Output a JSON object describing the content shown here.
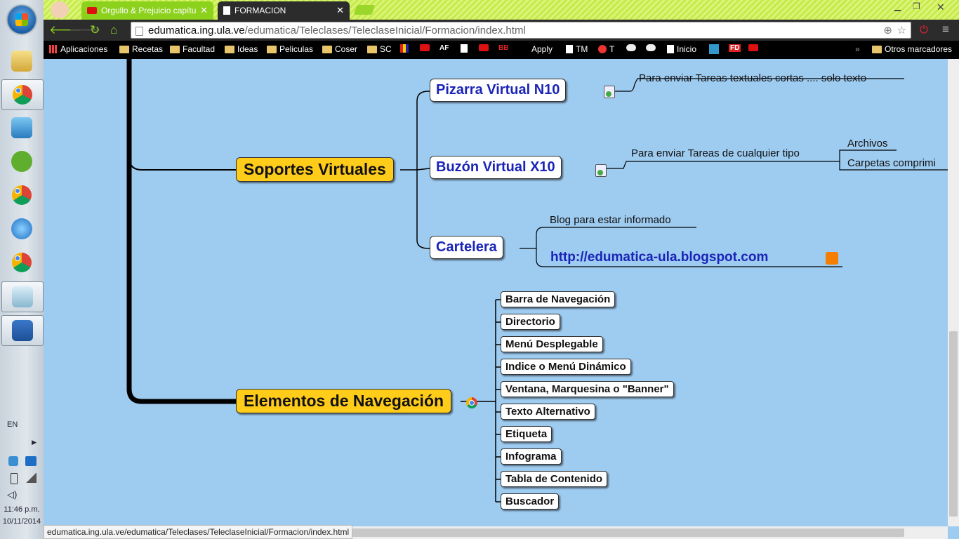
{
  "browser": {
    "tabs": [
      {
        "title": "Orgullo & Prejuicio capítu",
        "active": false,
        "icon": "youtube-icon"
      },
      {
        "title": "FORMACION",
        "active": true,
        "icon": "page-icon"
      }
    ],
    "url_host": "edumatica.ing.ula.ve",
    "url_path": "/edumatica/Teleclases/TeleclaseInicial/Formacion/index.html",
    "status_url": "edumatica.ing.ula.ve/edumatica/Teleclases/TeleclaseInicial/Formacion/index.html",
    "bookmarks": [
      {
        "label": "Aplicaciones",
        "icon": "apps-grid-icon"
      },
      {
        "label": "Recetas",
        "icon": "folder-icon"
      },
      {
        "label": "Facultad",
        "icon": "folder-icon"
      },
      {
        "label": "Ideas",
        "icon": "folder-icon"
      },
      {
        "label": "Peliculas",
        "icon": "folder-icon"
      },
      {
        "label": "Coser",
        "icon": "folder-icon"
      },
      {
        "label": "SC",
        "icon": "folder-icon"
      },
      {
        "label": "Apply",
        "icon": "none"
      },
      {
        "label": "TM",
        "icon": "page-icon"
      },
      {
        "label": "T",
        "icon": "tomato-icon"
      },
      {
        "label": "Inicio",
        "icon": "page-icon"
      }
    ],
    "other_bookmarks": "Otros marcadores"
  },
  "taskbar": {
    "language": "EN",
    "time": "11:46 p.m.",
    "date": "10/11/2014"
  },
  "mindmap": {
    "soportes": {
      "title": "Soportes Virtuales",
      "children": {
        "pizarra": {
          "title": "Pizarra Virtual N10",
          "note": "Para enviar Tareas textuales cortas .... solo texto"
        },
        "buzon": {
          "title": "Buzón Virtual X10",
          "note": "Para enviar Tareas de cualquier tipo",
          "sub1": "Archivos",
          "sub2": "Carpetas comprimi"
        },
        "cartelera": {
          "title": "Cartelera",
          "note": "Blog para estar informado",
          "link": "http://edumatica-ula.blogspot.com"
        }
      }
    },
    "elementos": {
      "title": "Elementos de Navegación",
      "items": [
        "Barra de Navegación",
        "Directorio",
        "Menú Desplegable",
        "Indice o Menú Dinámico",
        "Ventana, Marquesina o \"Banner\"",
        "Texto Alternativo",
        "Etiqueta",
        "Infograma",
        "Tabla de Contenido",
        "Buscador"
      ]
    }
  },
  "colors": {
    "background": "#9ecbf0",
    "main_node": "#ffcc1a",
    "blue_text": "#1a24b8",
    "tab_accent": "#8cd11c"
  }
}
